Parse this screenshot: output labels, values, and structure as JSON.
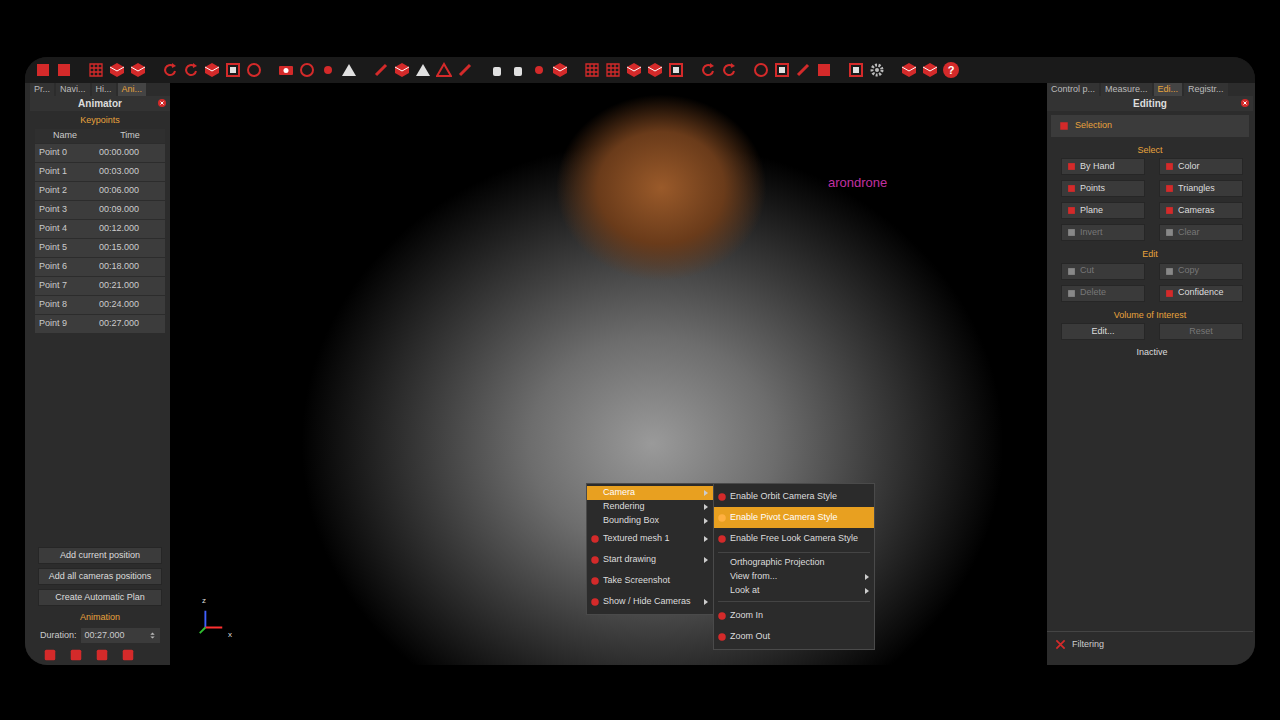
{
  "toolbar": {
    "help": "?"
  },
  "left_panel": {
    "tabs": [
      {
        "label": "Pr...",
        "selected": false
      },
      {
        "label": "Navi...",
        "selected": false
      },
      {
        "label": "Hi...",
        "selected": false
      },
      {
        "label": "Ani...",
        "selected": true
      }
    ],
    "title": "Animator",
    "keypoints": {
      "header": "Keypoints",
      "columns": [
        "Name",
        "Time"
      ],
      "rows": [
        [
          "Point 0",
          "00:00.000"
        ],
        [
          "Point 1",
          "00:03.000"
        ],
        [
          "Point 2",
          "00:06.000"
        ],
        [
          "Point 3",
          "00:09.000"
        ],
        [
          "Point 4",
          "00:12.000"
        ],
        [
          "Point 5",
          "00:15.000"
        ],
        [
          "Point 6",
          "00:18.000"
        ],
        [
          "Point 7",
          "00:21.000"
        ],
        [
          "Point 8",
          "00:24.000"
        ],
        [
          "Point 9",
          "00:27.000"
        ]
      ]
    },
    "buttons": [
      "Add current position",
      "Add all cameras positions",
      "Create Automatic Plan"
    ],
    "animation": {
      "header": "Animation",
      "duration_label": "Duration:",
      "duration": "00:27.000"
    }
  },
  "viewport": {
    "label": "arondrone",
    "axes": {
      "z": "z",
      "x": "x"
    }
  },
  "context_menu": {
    "items": [
      {
        "label": "Camera",
        "kind": "text",
        "submenu": true,
        "selected": true
      },
      {
        "label": "Rendering",
        "kind": "text",
        "submenu": true,
        "selected": false
      },
      {
        "label": "Bounding Box",
        "kind": "text",
        "submenu": true,
        "selected": false
      },
      {
        "label": "Textured mesh 1",
        "kind": "icon",
        "submenu": true,
        "selected": false
      },
      {
        "label": "Start drawing",
        "kind": "icon",
        "submenu": true,
        "selected": false
      },
      {
        "label": "Take Screenshot",
        "kind": "icon",
        "submenu": false,
        "selected": false
      },
      {
        "label": "Show / Hide Cameras",
        "kind": "icon",
        "submenu": true,
        "selected": false
      }
    ]
  },
  "submenu": {
    "items": [
      {
        "label": "Enable Orbit Camera Style",
        "kind": "icon",
        "submenu": false,
        "selected": false
      },
      {
        "label": "Enable Pivot Camera Style",
        "kind": "icon",
        "submenu": false,
        "selected": true
      },
      {
        "label": "Enable Free Look Camera Style",
        "kind": "icon",
        "submenu": false,
        "selected": false
      },
      {
        "label": "",
        "kind": "separator",
        "submenu": false,
        "selected": false
      },
      {
        "label": "Orthographic Projection",
        "kind": "text",
        "submenu": false,
        "selected": false
      },
      {
        "label": "View from...",
        "kind": "text",
        "submenu": true,
        "selected": false
      },
      {
        "label": "Look at",
        "kind": "text",
        "submenu": true,
        "selected": false
      },
      {
        "label": "",
        "kind": "separator",
        "submenu": false,
        "selected": false
      },
      {
        "label": "Zoom In",
        "kind": "icon",
        "submenu": false,
        "selected": false
      },
      {
        "label": "Zoom Out",
        "kind": "icon",
        "submenu": false,
        "selected": false
      }
    ]
  },
  "right_panel": {
    "tabs": [
      {
        "label": "Control p...",
        "selected": false
      },
      {
        "label": "Measure...",
        "selected": false
      },
      {
        "label": "Edi...",
        "selected": true
      },
      {
        "label": "Registr...",
        "selected": false
      }
    ],
    "title": "Editing",
    "section": "Selection",
    "groups": [
      {
        "label": "Select",
        "buttons": [
          {
            "label": "By Hand",
            "disabled": false
          },
          {
            "label": "Color",
            "disabled": false
          },
          {
            "label": "Points",
            "disabled": false
          },
          {
            "label": "Triangles",
            "disabled": false
          },
          {
            "label": "Plane",
            "disabled": false
          },
          {
            "label": "Cameras",
            "disabled": false
          },
          {
            "label": "Invert",
            "disabled": true
          },
          {
            "label": "Clear",
            "disabled": true
          }
        ]
      },
      {
        "label": "Edit",
        "buttons": [
          {
            "label": "Cut",
            "disabled": true
          },
          {
            "label": "Copy",
            "disabled": true
          },
          {
            "label": "Delete",
            "disabled": true
          },
          {
            "label": "Confidence",
            "disabled": false
          }
        ]
      },
      {
        "label": "Volume of Interest",
        "buttons": [
          {
            "label": "Edit...",
            "disabled": false
          },
          {
            "label": "Reset",
            "disabled": true
          }
        ],
        "status": "Inactive"
      }
    ],
    "footer": "Filtering"
  }
}
